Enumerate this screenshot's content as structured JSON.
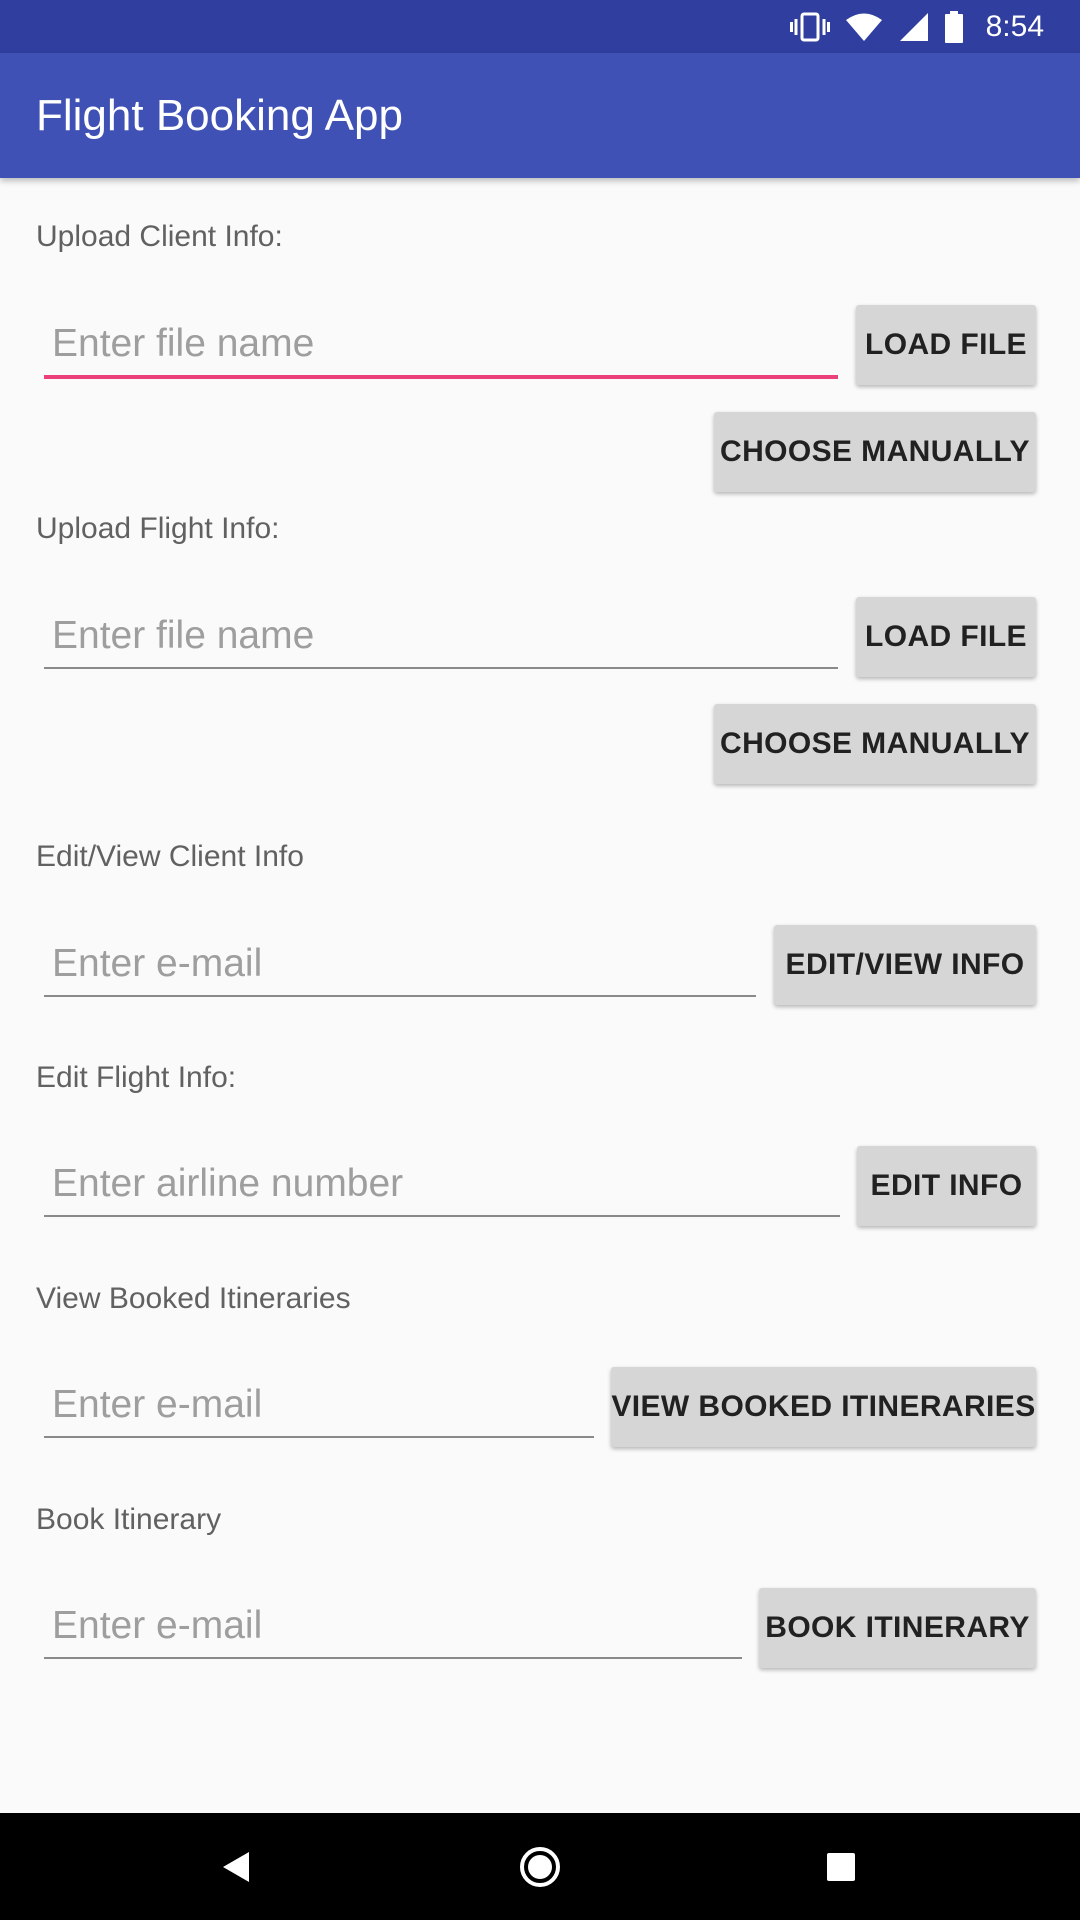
{
  "status": {
    "time": "8:54",
    "icons": [
      "vibrate-icon",
      "wifi-icon",
      "cell-signal-icon",
      "battery-icon"
    ]
  },
  "app": {
    "title": "Flight Booking App"
  },
  "sections": [
    {
      "label": "Upload Client Info:",
      "placeholder": "Enter file name",
      "button": "LOAD FILE",
      "extra_button": "CHOOSE MANUALLY"
    },
    {
      "label": "Upload Flight Info:",
      "placeholder": "Enter file name",
      "button": "LOAD FILE",
      "extra_button": "CHOOSE MANUALLY"
    },
    {
      "label": "Edit/View Client Info",
      "placeholder": "Enter e-mail",
      "button": "EDIT/VIEW INFO"
    },
    {
      "label": "Edit Flight Info:",
      "placeholder": "Enter airline number",
      "button": "EDIT INFO"
    },
    {
      "label": "View Booked Itineraries",
      "placeholder": "Enter e-mail",
      "button": "VIEW BOOKED ITINERARIES"
    },
    {
      "label": "Book Itinerary",
      "placeholder": "Enter e-mail",
      "button": "BOOK ITINERARY"
    }
  ],
  "nav": {
    "icons": [
      "back-icon",
      "home-icon",
      "recents-icon"
    ]
  },
  "colors": {
    "status_bar": "#303f9f",
    "app_bar": "#3f51b5",
    "focus_accent": "#ec407a",
    "button_bg": "#d6d6d6"
  }
}
